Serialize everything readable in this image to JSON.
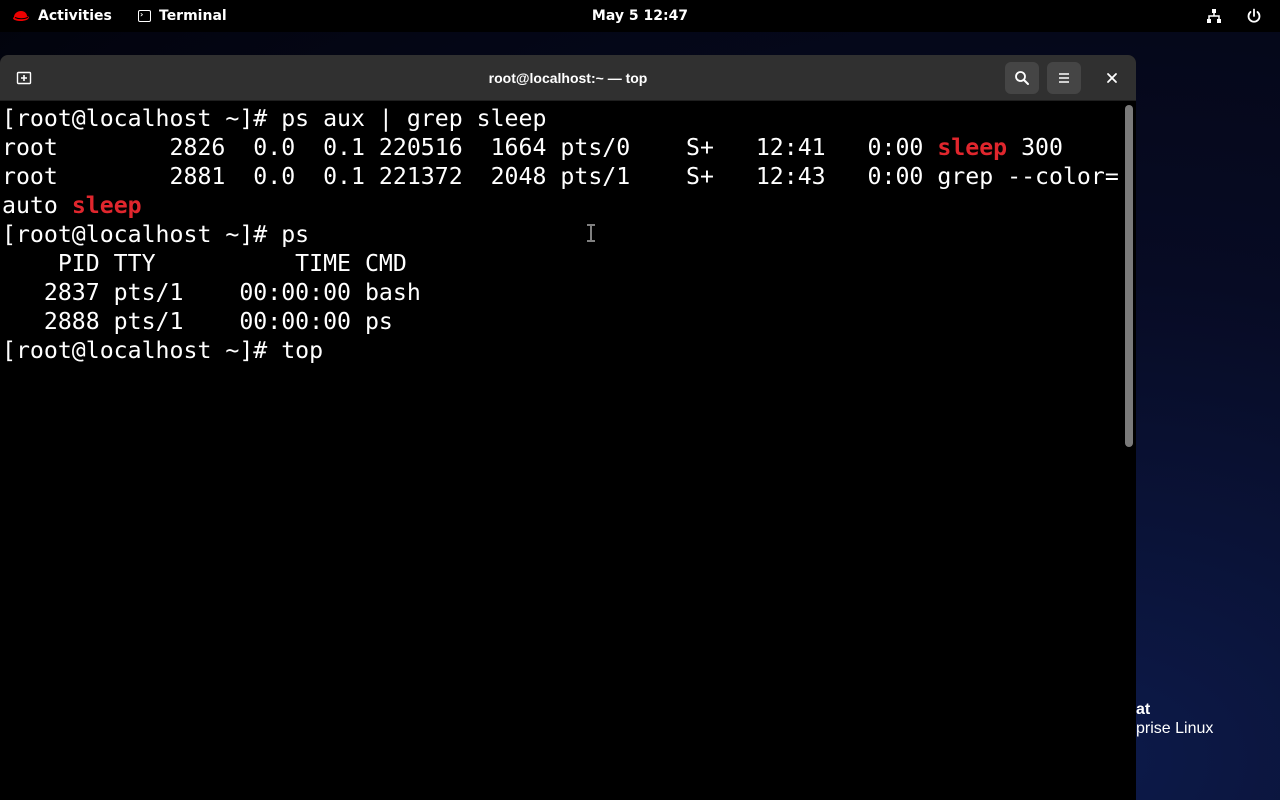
{
  "topbar": {
    "activities_label": "Activities",
    "app_label": "Terminal",
    "clock": "May 5  12:47",
    "network_icon": "network-wired-icon",
    "power_icon": "power-icon"
  },
  "branding": {
    "line1": "at",
    "line2": "prise Linux"
  },
  "window": {
    "title": "root@localhost:~ — top",
    "new_tab_icon": "new-tab-icon",
    "search_icon": "search-icon",
    "menu_icon": "hamburger-menu-icon",
    "close_icon": "close-icon"
  },
  "terminal": {
    "lines": [
      {
        "segments": [
          {
            "text": "[root@localhost ~]# ps aux | grep sleep",
            "hl": false
          }
        ]
      },
      {
        "segments": [
          {
            "text": "root        2826  0.0  0.1 220516  1664 pts/0    S+   12:41   0:00 ",
            "hl": false
          },
          {
            "text": "sleep",
            "hl": true
          },
          {
            "text": " 300",
            "hl": false
          }
        ]
      },
      {
        "segments": [
          {
            "text": "root        2881  0.0  0.1 221372  2048 pts/1    S+   12:43   0:00 grep --color=",
            "hl": false
          }
        ]
      },
      {
        "segments": [
          {
            "text": "auto ",
            "hl": false
          },
          {
            "text": "sleep",
            "hl": true
          }
        ]
      },
      {
        "segments": [
          {
            "text": "[root@localhost ~]# ps",
            "hl": false
          }
        ]
      },
      {
        "segments": [
          {
            "text": "    PID TTY          TIME CMD",
            "hl": false
          }
        ]
      },
      {
        "segments": [
          {
            "text": "   2837 pts/1    00:00:00 bash",
            "hl": false
          }
        ]
      },
      {
        "segments": [
          {
            "text": "   2888 pts/1    00:00:00 ps",
            "hl": false
          }
        ]
      },
      {
        "segments": [
          {
            "text": "[root@localhost ~]# top",
            "hl": false
          }
        ]
      }
    ]
  },
  "colors": {
    "highlight": "#e0262d",
    "headerbar": "#303030",
    "terminal_bg": "#000000",
    "terminal_fg": "#ffffff"
  }
}
